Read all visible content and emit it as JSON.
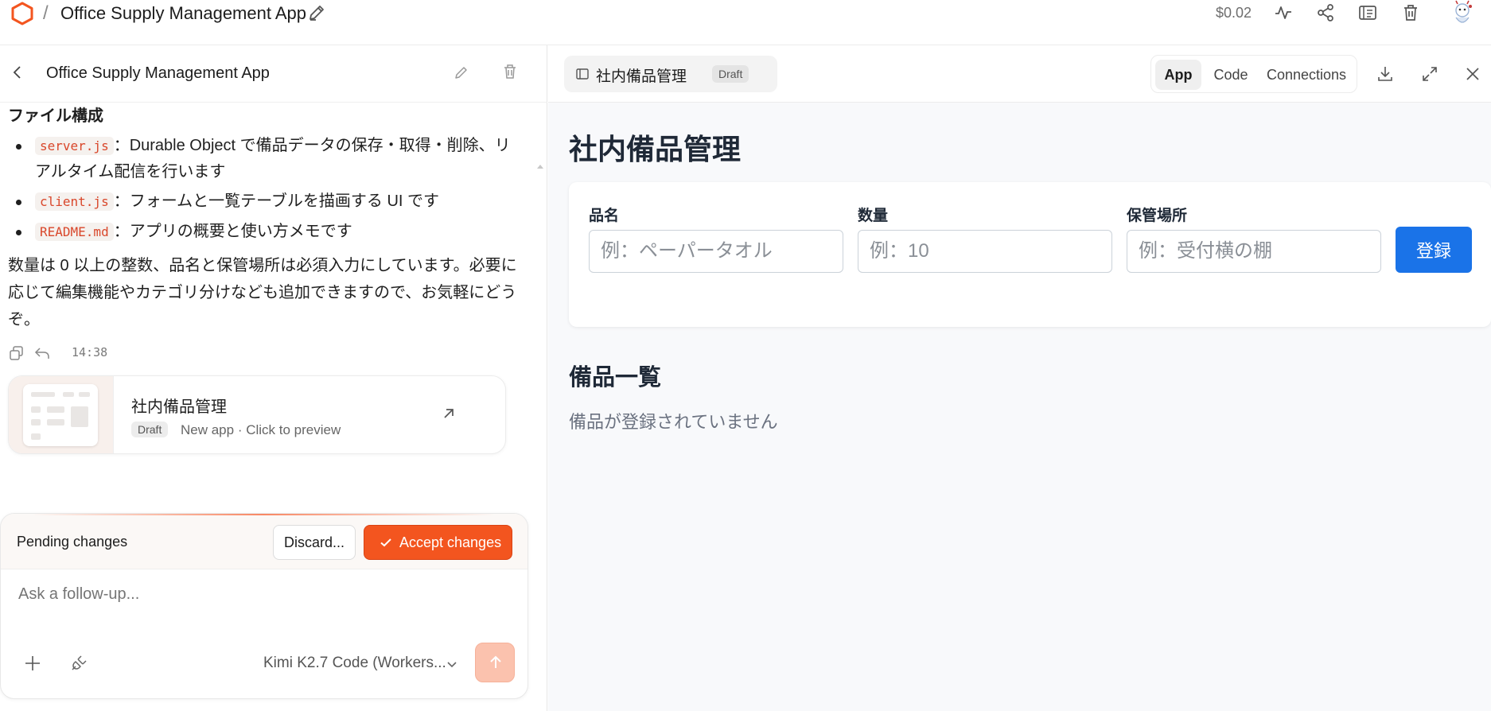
{
  "topbar": {
    "logo_icon": "hexagon-logo-icon",
    "separator": "/",
    "title": "Office Supply Management App",
    "cost": "$0.02",
    "icons": [
      "edit-icon",
      "activity-icon",
      "share-icon",
      "settings-icon",
      "trash-icon",
      "avatar"
    ],
    "accent": "#f3551f"
  },
  "left_panel": {
    "header_title": "Office Supply Management App",
    "section_title": "ファイル構成",
    "files": [
      {
        "name": "server.js",
        "desc": "：Durable Object で備品データの保存・取得・削除、リアルタイム配信を行います"
      },
      {
        "name": "client.js",
        "desc": "：フォームと一覧テーブルを描画する UI です"
      },
      {
        "name": "README.md",
        "desc": "：アプリの概要と使い方メモです"
      }
    ],
    "paragraph": "数量は 0 以上の整数、品名と保管場所は必須入力にしています。必要に応じて編集機能やカテゴリ分けなども追加できますので、お気軽にどうぞ。",
    "timestamp": "14:38",
    "preview_card": {
      "title": "社内備品管理",
      "badge": "Draft",
      "subtitle": "New app · Click to preview"
    }
  },
  "composer": {
    "pending_label": "Pending changes",
    "discard_label": "Discard...",
    "accept_label": "Accept changes",
    "placeholder": "Ask a follow-up...",
    "model": "Kimi K2.7 Code (Workers..."
  },
  "right_panel": {
    "file_tab": "社内備品管理",
    "file_badge": "Draft",
    "tabs": [
      "App",
      "Code",
      "Connections"
    ],
    "active_tab": "App"
  },
  "app_preview": {
    "title": "社内備品管理",
    "fields": [
      {
        "label": "品名",
        "placeholder": "例：ペーパータオル"
      },
      {
        "label": "数量",
        "placeholder": "例：10"
      },
      {
        "label": "保管場所",
        "placeholder": "例：受付横の棚"
      }
    ],
    "submit_label": "登録",
    "list_title": "備品一覧",
    "empty_message": "備品が登録されていません",
    "primary_color": "#1a73e8"
  }
}
